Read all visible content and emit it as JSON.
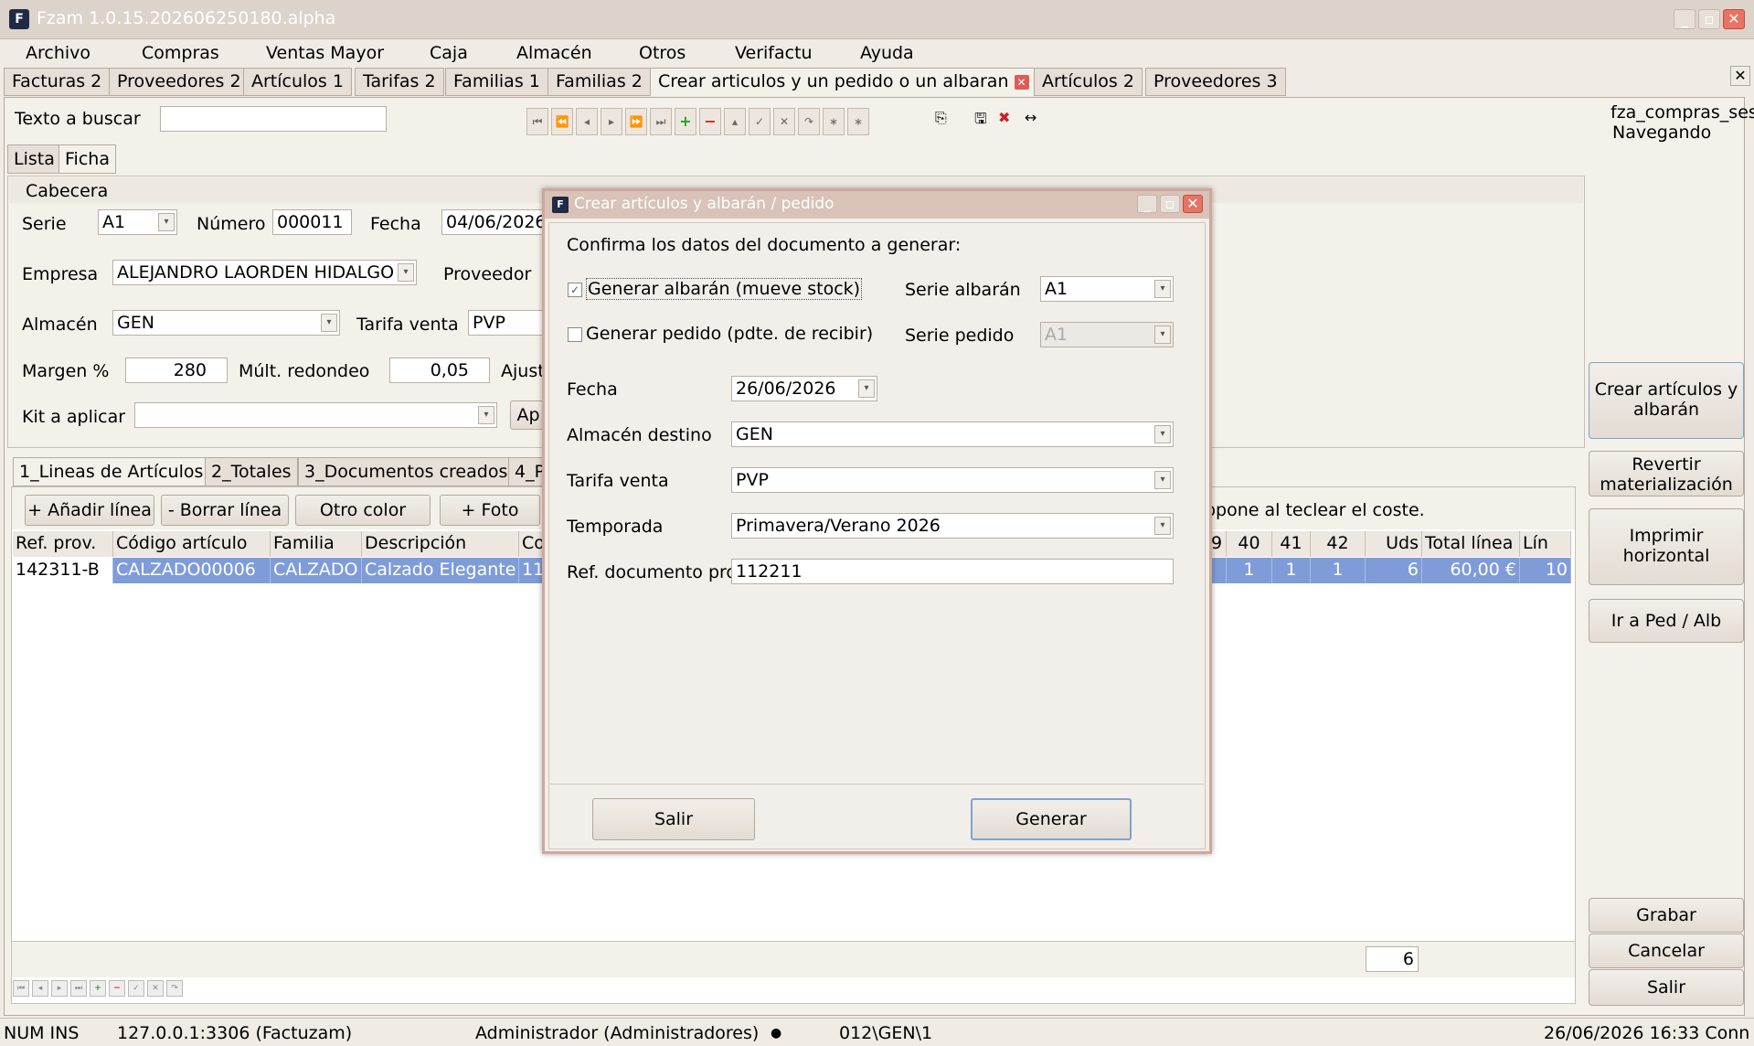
{
  "window": {
    "title": "Fzam 1.0.15.202606250180.alpha",
    "logo": "F"
  },
  "menubar": [
    "Archivo",
    "Compras",
    "Ventas Mayor",
    "Caja",
    "Almacén",
    "Otros",
    "Verifactu",
    "Ayuda"
  ],
  "doc_tabs": [
    "Facturas 2",
    "Proveedores 2",
    "Artículos 1",
    "Tarifas 2",
    "Familias 1",
    "Familias 2",
    "Crear articulos y un pedido o un albaran",
    "Artículos 2",
    "Proveedores 3"
  ],
  "search": {
    "label": "Texto a buscar",
    "value": ""
  },
  "session": {
    "user": "fza_compras_ses",
    "state": "Navegando"
  },
  "view_tabs": [
    "Lista",
    "Ficha"
  ],
  "header": {
    "section": "Cabecera",
    "serie_label": "Serie",
    "serie": "A1",
    "numero_label": "Número",
    "numero": "000011",
    "fecha_label": "Fecha",
    "fecha": "04/06/2026",
    "empresa_label": "Empresa",
    "empresa": "ALEJANDRO LAORDEN HIDALGO",
    "proveedor_label": "Proveedor",
    "almacen_label": "Almacén",
    "almacen": "GEN",
    "tarifa_label": "Tarifa venta",
    "tarifa": "PVP",
    "margen_label": "Margen %",
    "margen": "280",
    "mult_label": "Múlt. redondeo",
    "mult": "0,05",
    "ajuste_label": "Ajust",
    "kit_label": "Kit a aplicar",
    "kit": "",
    "aplicar_label": "Ap"
  },
  "line_tabs": [
    "1_Lineas de Artículos",
    "2_Totales",
    "3_Documentos creados",
    "4_P"
  ],
  "line_buttons": [
    "+ Añadir línea",
    "- Borrar línea",
    "Otro color",
    "+ Foto"
  ],
  "hint_text": "ppone al teclear el coste.",
  "grid": {
    "headers_left": [
      "Ref. prov.",
      "Código artículo",
      "Familia",
      "Descripción",
      "Co"
    ],
    "headers_right": [
      "9",
      "40",
      "41",
      "42",
      "Uds",
      "Total línea",
      "Lín"
    ],
    "row_left": [
      "142311-B",
      "CALZADO00006",
      "CALZADO",
      "Calzado Elegante",
      "11"
    ],
    "row_right": [
      "",
      "1",
      "1",
      "1",
      "6",
      "60,00 €",
      "10"
    ],
    "footer_total": "6"
  },
  "side_buttons": [
    "Crear artículos y albarán",
    "Revertir materialización",
    "Imprimir horizontal",
    "Ir a Ped / Alb",
    "Grabar",
    "Cancelar",
    "Salir"
  ],
  "statusbar": {
    "keys": "NUM  INS",
    "db": "127.0.0.1:3306 (Factuzam)",
    "user": "Administrador (Administradores)",
    "path": "012\\GEN\\1",
    "datetime": "26/06/2026 16:33 Conn"
  },
  "dialog": {
    "title": "Crear artículos y albarán / pedido",
    "prompt": "Confirma los datos del documento a generar:",
    "gen_albaran_label": "Generar albarán (mueve stock)",
    "gen_albaran_checked": true,
    "serie_albaran_label": "Serie albarán",
    "serie_albaran": "A1",
    "gen_pedido_label": "Generar pedido (pdte. de recibir)",
    "gen_pedido_checked": false,
    "serie_pedido_label": "Serie pedido",
    "serie_pedido": "A1",
    "fecha_label": "Fecha",
    "fecha": "26/06/2026",
    "almacen_label": "Almacén destino",
    "almacen": "GEN",
    "tarifa_label": "Tarifa venta",
    "tarifa": "PVP",
    "temporada_label": "Temporada",
    "temporada": "Primavera/Verano 2026",
    "ref_label": "Ref. documento pro",
    "ref": "112211",
    "salir": "Salir",
    "generar": "Generar"
  }
}
